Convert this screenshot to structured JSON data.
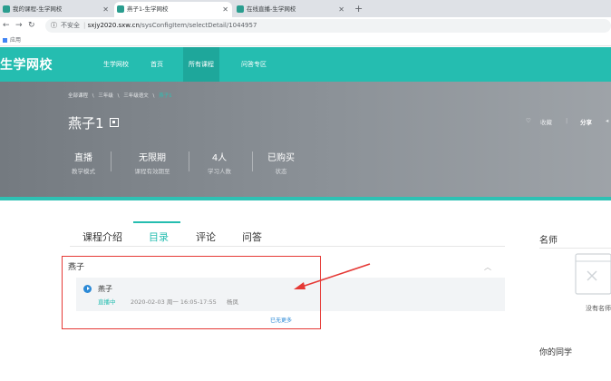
{
  "browser": {
    "tabs": [
      {
        "title": "我的课程-生学网校",
        "active": false
      },
      {
        "title": "燕子1-生学网校",
        "active": true
      },
      {
        "title": "在线直播-生学网校",
        "active": false
      }
    ],
    "new_tab": "+",
    "security": "不安全",
    "url_domain": "sxjy2020.sxw.cn",
    "url_path": "/sysConfigItem/selectDetail/1044957",
    "bookmark": "应用"
  },
  "site": {
    "logo": "生学网校",
    "nav": [
      {
        "label": "生学网校",
        "active": false
      },
      {
        "label": "首页",
        "active": false
      },
      {
        "label": "所有课程",
        "active": true
      },
      {
        "label": "问答专区",
        "active": false
      }
    ]
  },
  "course": {
    "breadcrumb": [
      "全部课程",
      "\\",
      "三年级",
      "\\",
      "三年级语文",
      "\\",
      "燕子1"
    ],
    "title": "燕子1",
    "stats": [
      {
        "value": "直播",
        "label": "教学模式"
      },
      {
        "value": "无限期",
        "label": "课程有效期至"
      },
      {
        "value": "4人",
        "label": "学习人数"
      },
      {
        "value": "已购买",
        "label": "状态"
      }
    ],
    "actions": {
      "favorite": "收藏",
      "share": "分享"
    }
  },
  "content": {
    "tabs": [
      {
        "label": "课程介绍",
        "active": false
      },
      {
        "label": "目录",
        "active": true
      },
      {
        "label": "评论",
        "active": false
      },
      {
        "label": "问答",
        "active": false
      }
    ],
    "chapter": "燕子",
    "lesson": {
      "title": "燕子",
      "status": "直播中",
      "time": "2020-02-03  周一  16:05-17:55",
      "teacher": "杨凤"
    },
    "show_more": "已无更多"
  },
  "sidebar": {
    "teacher_title": "名师",
    "empty_text": "没有名师",
    "classmates_title": "你的同学"
  },
  "colors": {
    "brand": "#25bdb0",
    "highlight": "#e53935",
    "link": "#2b89d6"
  }
}
